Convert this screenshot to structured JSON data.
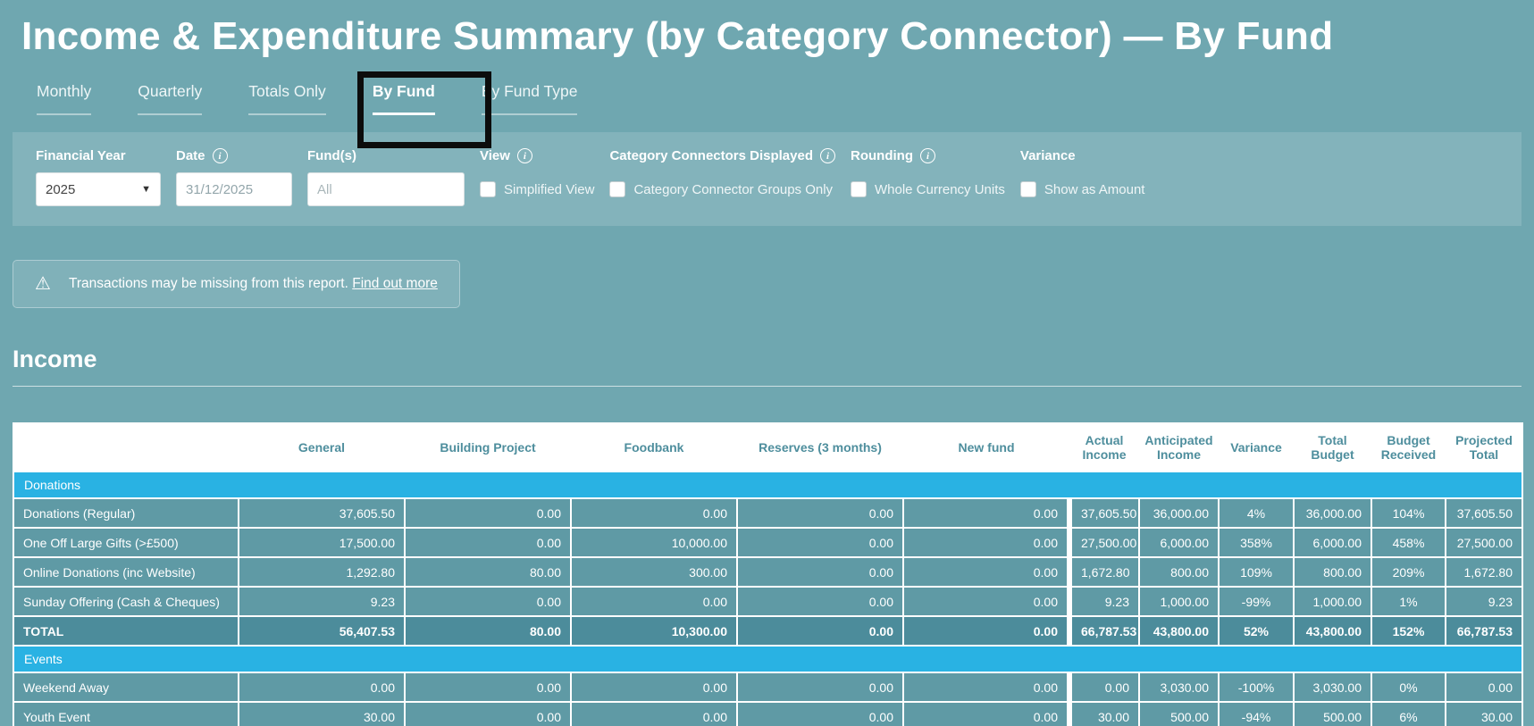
{
  "page": {
    "title": "Income & Expenditure Summary (by Category Connector) — By Fund"
  },
  "tabs": [
    {
      "label": "Monthly",
      "active": false
    },
    {
      "label": "Quarterly",
      "active": false
    },
    {
      "label": "Totals Only",
      "active": false
    },
    {
      "label": "By Fund",
      "active": true
    },
    {
      "label": "By Fund Type",
      "active": false
    }
  ],
  "filters": {
    "financial_year": {
      "label": "Financial Year",
      "value": "2025"
    },
    "date": {
      "label": "Date",
      "value": "31/12/2025"
    },
    "funds": {
      "label": "Fund(s)",
      "placeholder": "All"
    },
    "view": {
      "label": "View",
      "checkbox_label": "Simplified View",
      "checked": false
    },
    "connectors": {
      "label": "Category Connectors Displayed",
      "checkbox_label": "Category Connector Groups Only",
      "checked": false
    },
    "rounding": {
      "label": "Rounding",
      "checkbox_label": "Whole Currency Units",
      "checked": false
    },
    "variance": {
      "label": "Variance",
      "checkbox_label": "Show as Amount",
      "checked": false
    }
  },
  "warning": {
    "text": "Transactions may be missing from this report.",
    "link_label": "Find out more"
  },
  "income_section": {
    "title": "Income"
  },
  "colors": {
    "background": "#6FA7B0",
    "section_row": "#29B2E3",
    "data_row": "#5F9AA5",
    "total_row": "#4C8C9B",
    "header_text": "#4E8E9D"
  },
  "table": {
    "columns": [
      "",
      "General",
      "Building Project",
      "Foodbank",
      "Reserves (3 months)",
      "New fund",
      "Actual Income",
      "Anticipated Income",
      "Variance",
      "Total Budget",
      "Budget Received",
      "Projected Total"
    ],
    "groups": [
      {
        "name": "Donations",
        "rows": [
          {
            "label": "Donations (Regular)",
            "values": [
              "37,605.50",
              "0.00",
              "0.00",
              "0.00",
              "0.00",
              "37,605.50",
              "36,000.00",
              "4%",
              "36,000.00",
              "104%",
              "37,605.50"
            ]
          },
          {
            "label": "One Off Large Gifts (>£500)",
            "values": [
              "17,500.00",
              "0.00",
              "10,000.00",
              "0.00",
              "0.00",
              "27,500.00",
              "6,000.00",
              "358%",
              "6,000.00",
              "458%",
              "27,500.00"
            ]
          },
          {
            "label": "Online Donations (inc Website)",
            "values": [
              "1,292.80",
              "80.00",
              "300.00",
              "0.00",
              "0.00",
              "1,672.80",
              "800.00",
              "109%",
              "800.00",
              "209%",
              "1,672.80"
            ]
          },
          {
            "label": "Sunday Offering (Cash & Cheques)",
            "values": [
              "9.23",
              "0.00",
              "0.00",
              "0.00",
              "0.00",
              "9.23",
              "1,000.00",
              "-99%",
              "1,000.00",
              "1%",
              "9.23"
            ]
          }
        ],
        "total": {
          "label": "TOTAL",
          "values": [
            "56,407.53",
            "80.00",
            "10,300.00",
            "0.00",
            "0.00",
            "66,787.53",
            "43,800.00",
            "52%",
            "43,800.00",
            "152%",
            "66,787.53"
          ]
        }
      },
      {
        "name": "Events",
        "rows": [
          {
            "label": "Weekend Away",
            "values": [
              "0.00",
              "0.00",
              "0.00",
              "0.00",
              "0.00",
              "0.00",
              "3,030.00",
              "-100%",
              "3,030.00",
              "0%",
              "0.00"
            ]
          },
          {
            "label": "Youth Event",
            "values": [
              "30.00",
              "0.00",
              "0.00",
              "0.00",
              "0.00",
              "30.00",
              "500.00",
              "-94%",
              "500.00",
              "6%",
              "30.00"
            ]
          }
        ]
      }
    ]
  }
}
